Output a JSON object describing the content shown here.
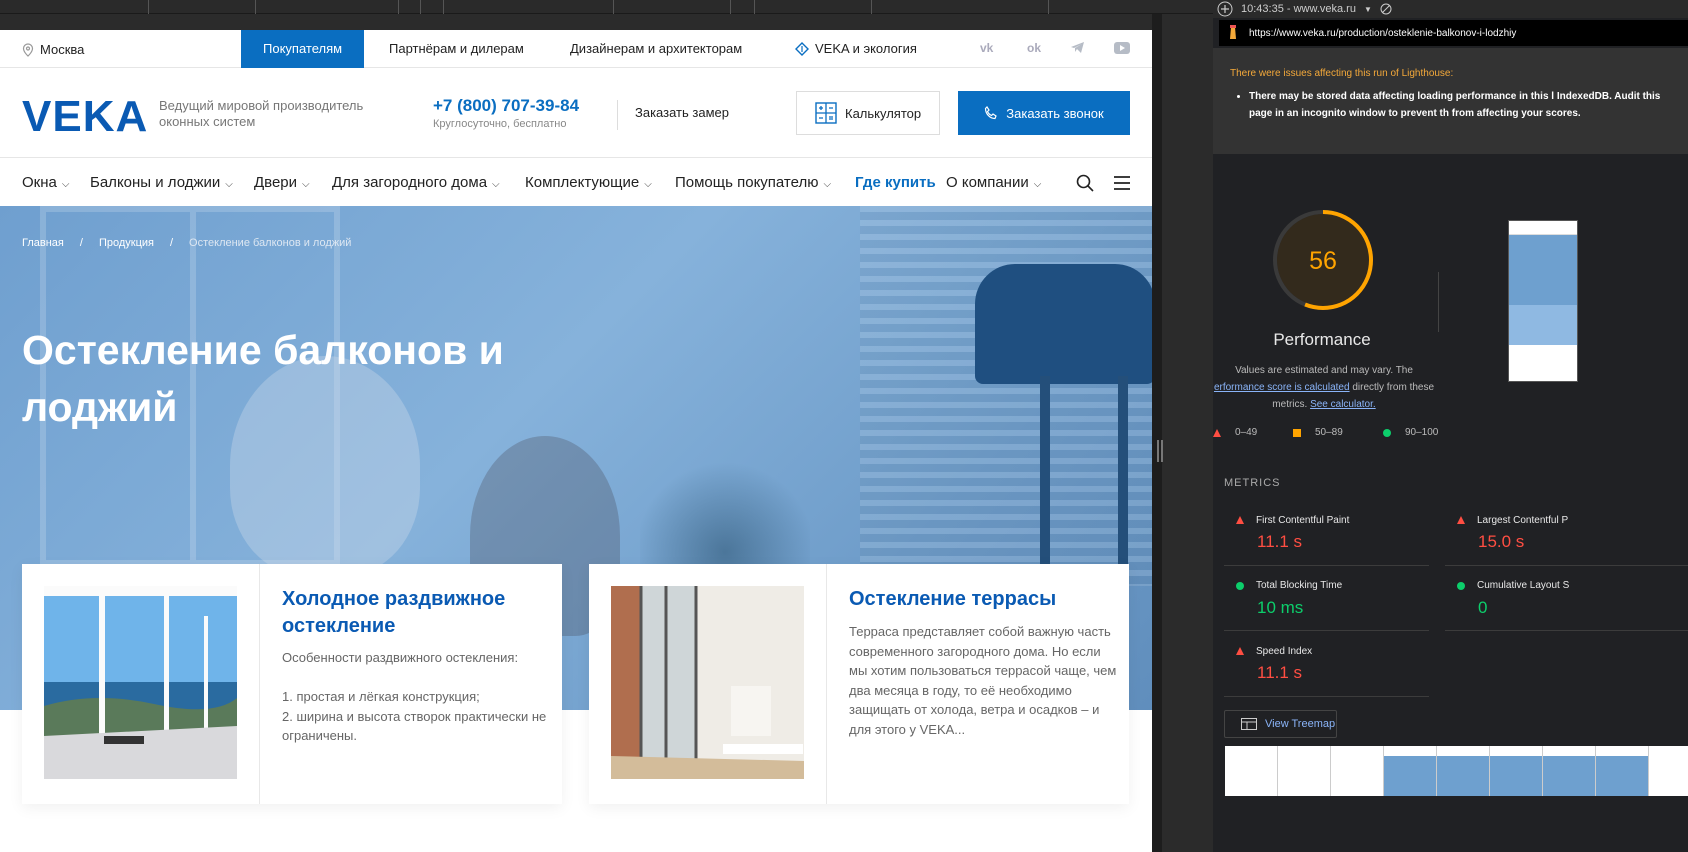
{
  "utility": {
    "city": "Москва",
    "tabs": [
      "Покупателям",
      "Партнёрам и дилерам",
      "Дизайнерам и архитекторам",
      "VEKA и экология"
    ],
    "social": [
      "vk",
      "ok",
      "telegram",
      "youtube"
    ]
  },
  "header": {
    "logo": "VEKA",
    "tagline": "Ведущий мировой производитель оконных систем",
    "phone": "+7 (800) 707-39-84",
    "phone_sub": "Круглосуточно, бесплатно",
    "measure": "Заказать замер",
    "calculator": "Калькулятор",
    "call": "Заказать звонок"
  },
  "menu": [
    "Окна",
    "Балконы и лоджии",
    "Двери",
    "Для загородного дома",
    "Комплектующие",
    "Помощь покупателю",
    "Где купить",
    "О компании"
  ],
  "breadcrumbs": [
    "Главная",
    "/",
    "Продукция",
    "/",
    "Остекление балконов и лоджий"
  ],
  "hero": {
    "title": "Остекление балконов и лоджий"
  },
  "cards": [
    {
      "title": "Холодное раздвижное остекление",
      "text": "Особенности раздвижного остекления:\n\n1. простая и лёгкая конструкция;\n2. ширина и высота створок практически не ограничены."
    },
    {
      "title": "Остекление террасы",
      "text": "Терраса представляет собой важную часть современного загородного дома. Но если мы хотим пользоваться террасой чаще, чем два месяца в году, то её необходимо защищать от холода, ветра и осадков – и для этого у VEKA..."
    }
  ],
  "devtools": {
    "time": "10:43:35 - www.veka.ru",
    "url": "https://www.veka.ru/production/osteklenie-balkonov-i-lodzhiy",
    "warning_title": "There were issues affecting this run of Lighthouse:",
    "warning_item": "There may be stored data affecting loading performance in this l IndexedDB. Audit this page in an incognito window to prevent th from affecting your scores.",
    "score": "56",
    "score_fraction": 0.56,
    "perf_label": "Performance",
    "note_a": "Values are estimated and may vary. The",
    "note_link": "erformance score is calculated",
    "note_b": "directly from these",
    "note_c": "metrics.",
    "note_link2": "See calculator.",
    "legend": [
      "0–49",
      "50–89",
      "90–100"
    ],
    "metrics_title": "METRICS",
    "metrics": [
      {
        "name": "First Contentful Paint",
        "value": "11.1 s",
        "status": "bad"
      },
      {
        "name": "Largest Contentful P",
        "value": "15.0 s",
        "status": "bad"
      },
      {
        "name": "Total Blocking Time",
        "value": "10 ms",
        "status": "good"
      },
      {
        "name": "Cumulative Layout S",
        "value": "0",
        "status": "good"
      },
      {
        "name": "Speed Index",
        "value": "11.1 s",
        "status": "bad"
      }
    ],
    "treemap": "View Treemap"
  },
  "colors": {
    "brand": "#0a6ec1",
    "bad": "#ff4e42",
    "good": "#0cce6b",
    "avg": "#ffa400"
  }
}
